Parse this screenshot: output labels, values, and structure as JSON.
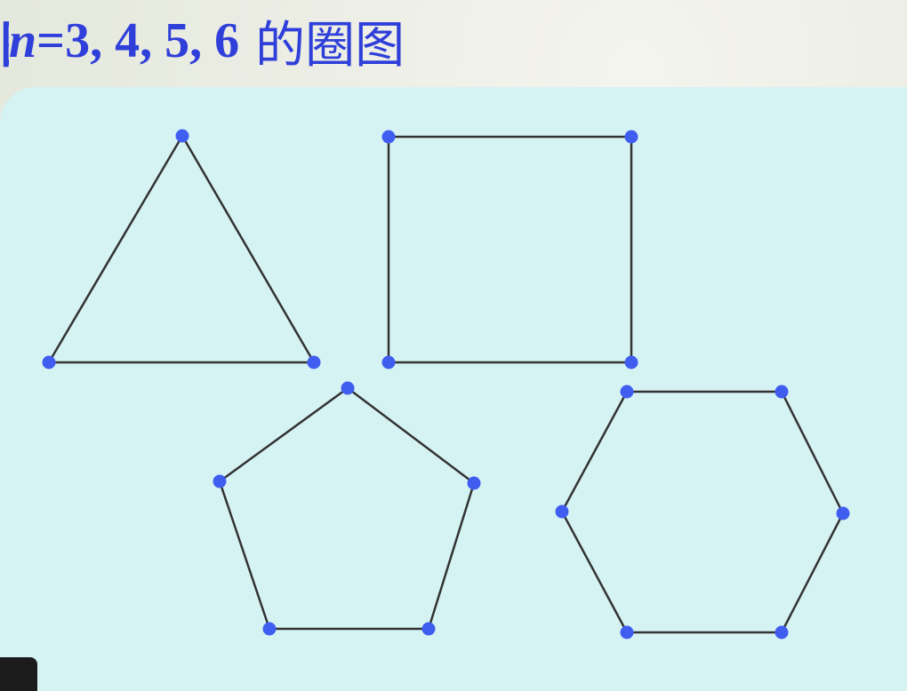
{
  "title": {
    "partial_char": "图",
    "variable": "n",
    "equals": "=3, 4, 5, 6",
    "suffix": "的圈图"
  },
  "colors": {
    "title": "#2f3fd9",
    "panel": "#d6f3f4",
    "edge": "#333333",
    "vertex": "#3f5ef0"
  },
  "graphs": [
    {
      "name": "cycle-graph-c3",
      "vertex_count": 3,
      "shape": "triangle"
    },
    {
      "name": "cycle-graph-c4",
      "vertex_count": 4,
      "shape": "square"
    },
    {
      "name": "cycle-graph-c5",
      "vertex_count": 5,
      "shape": "pentagon"
    },
    {
      "name": "cycle-graph-c6",
      "vertex_count": 6,
      "shape": "hexagon"
    }
  ]
}
